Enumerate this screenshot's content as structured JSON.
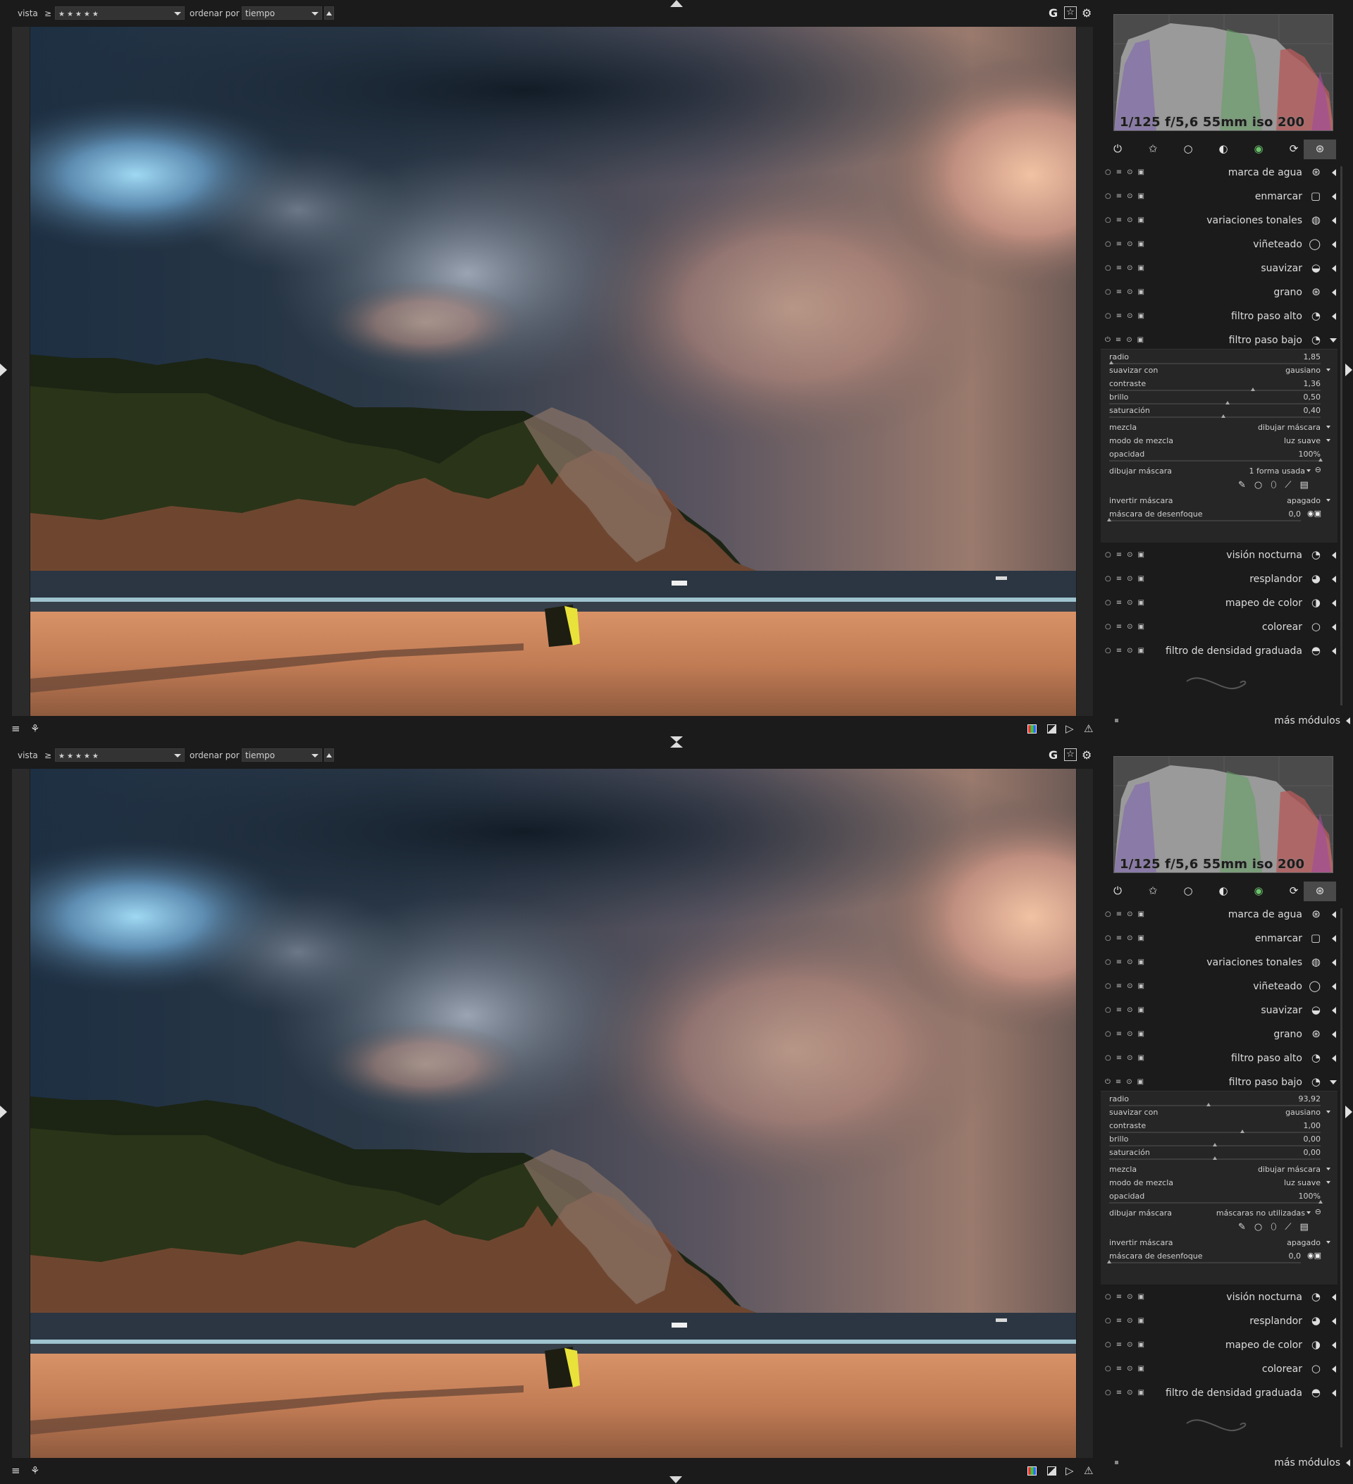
{
  "toolbar": {
    "vista_label": "vista",
    "comparator": "≥",
    "rating_value": "★★★★★",
    "sort_label": "ordenar por",
    "sort_value": "tiempo",
    "right_icons": [
      "G",
      "star-grid-icon",
      "gear-icon"
    ]
  },
  "histogram": {
    "exif": "1/125 f/5,6 55mm iso 200"
  },
  "module_groups": [
    "power-icon",
    "star-icon",
    "circle-icon",
    "filled-circle-icon",
    "color-circle-icon",
    "loop-icon",
    "effects-icon"
  ],
  "modules_top": [
    {
      "name": "marca de agua"
    },
    {
      "name": "enmarcar"
    },
    {
      "name": "variaciones tonales"
    },
    {
      "name": "viñeteado"
    },
    {
      "name": "suavizar"
    },
    {
      "name": "grano"
    },
    {
      "name": "filtro paso alto"
    },
    {
      "name": "filtro paso bajo"
    }
  ],
  "modules_bottom": [
    {
      "name": "visión nocturna"
    },
    {
      "name": "resplandor"
    },
    {
      "name": "mapeo de color"
    },
    {
      "name": "colorear"
    },
    {
      "name": "filtro de densidad graduada"
    }
  ],
  "more_modules": "más módulos",
  "param_labels": {
    "radio": "radio",
    "suavizar_con": "suavizar con",
    "contraste": "contraste",
    "brillo": "brillo",
    "saturacion": "saturación",
    "mezcla": "mezcla",
    "modo_mezcla": "modo de mezcla",
    "opacidad": "opacidad",
    "dibujar_mascara": "dibujar máscara",
    "invertir": "invertir máscara",
    "desenfoque": "máscara de desenfoque"
  },
  "views": [
    {
      "radio": "1,85",
      "radio_pos": 0.01,
      "suavizar_con": "gausiano",
      "contraste": "1,36",
      "contraste_pos": 0.68,
      "brillo": "0,50",
      "brillo_pos": 0.56,
      "saturacion": "0,40",
      "saturacion_pos": 0.54,
      "mezcla": "dibujar máscara",
      "modo_mezcla": "luz suave",
      "opacidad": "100%",
      "opacidad_pos": 1.0,
      "dibujar_mascara": "1 forma usada",
      "invertir": "apagado",
      "desenfoque": "0,0",
      "desenfoque_pos": 0.0
    },
    {
      "radio": "93,92",
      "radio_pos": 0.47,
      "suavizar_con": "gausiano",
      "contraste": "1,00",
      "contraste_pos": 0.63,
      "brillo": "0,00",
      "brillo_pos": 0.5,
      "saturacion": "0,00",
      "saturacion_pos": 0.5,
      "mezcla": "dibujar máscara",
      "modo_mezcla": "luz suave",
      "opacidad": "100%",
      "opacidad_pos": 1.0,
      "dibujar_mascara": "máscaras no utilizadas",
      "invertir": "apagado",
      "desenfoque": "0,0",
      "desenfoque_pos": 0.0
    }
  ]
}
